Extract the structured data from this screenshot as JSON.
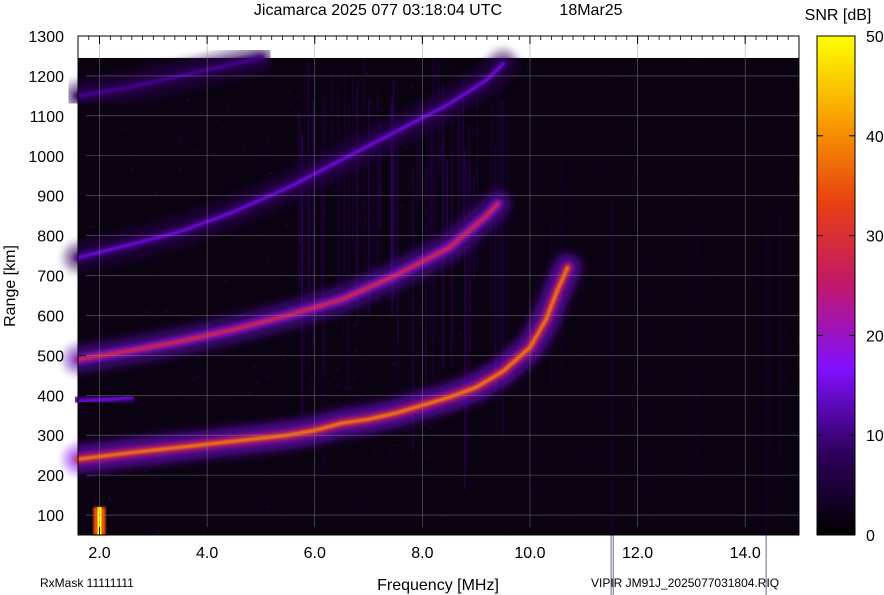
{
  "header": {
    "title": "Jicamarca 2025 077 03:18:04 UTC",
    "date": "18Mar25"
  },
  "footer": {
    "rxmask": "RxMask 11111111",
    "file": "VIPIR  JM91J_2025077031804.RIQ"
  },
  "chart_data": {
    "type": "heatmap",
    "title": "Jicamarca 2025 077 03:18:04 UTC",
    "xlabel": "Frequency [MHz]",
    "ylabel": "Range [km]",
    "xlim": [
      1.6,
      15.0
    ],
    "ylim": [
      50,
      1300
    ],
    "x_ticks": [
      {
        "value": 2,
        "label": "2.0"
      },
      {
        "value": 4,
        "label": "4.0"
      },
      {
        "value": 6,
        "label": "6.0"
      },
      {
        "value": 8,
        "label": "8.0"
      },
      {
        "value": 10,
        "label": "10.0"
      },
      {
        "value": 12,
        "label": "12.0"
      },
      {
        "value": 14,
        "label": "14.0"
      }
    ],
    "y_ticks": [
      {
        "value": 100,
        "label": "100"
      },
      {
        "value": 200,
        "label": "200"
      },
      {
        "value": 300,
        "label": "300"
      },
      {
        "value": 400,
        "label": "400"
      },
      {
        "value": 500,
        "label": "500"
      },
      {
        "value": 600,
        "label": "600"
      },
      {
        "value": 700,
        "label": "700"
      },
      {
        "value": 800,
        "label": "800"
      },
      {
        "value": 900,
        "label": "900"
      },
      {
        "value": 1000,
        "label": "1000"
      },
      {
        "value": 1100,
        "label": "1100"
      },
      {
        "value": 1200,
        "label": "1200"
      },
      {
        "value": 1300,
        "label": "1300"
      }
    ],
    "grid": true,
    "data_range_top_km": 1245,
    "colorbar": {
      "label": "SNR [dB]",
      "range": [
        0,
        50
      ],
      "ticks": [
        {
          "value": 0,
          "label": "0"
        },
        {
          "value": 10,
          "label": "10"
        },
        {
          "value": 20,
          "label": "20"
        },
        {
          "value": 30,
          "label": "30"
        },
        {
          "value": 40,
          "label": "40"
        },
        {
          "value": 50,
          "label": "50"
        }
      ],
      "stops": [
        "#000000",
        "#30005e",
        "#8010ff",
        "#c0186a",
        "#e84010",
        "#f8a000",
        "#ffff00"
      ]
    },
    "traces": [
      {
        "id": "first-hop",
        "points": [
          [
            1.6,
            240
          ],
          [
            2.5,
            255
          ],
          [
            3.5,
            270
          ],
          [
            4.5,
            285
          ],
          [
            5.5,
            300
          ],
          [
            6.0,
            312
          ],
          [
            6.5,
            330
          ],
          [
            7.0,
            340
          ],
          [
            7.5,
            355
          ],
          [
            8.0,
            375
          ],
          [
            8.5,
            395
          ],
          [
            9.0,
            420
          ],
          [
            9.5,
            460
          ],
          [
            10.0,
            520
          ],
          [
            10.3,
            590
          ],
          [
            10.5,
            660
          ],
          [
            10.7,
            720
          ]
        ],
        "snr_db": 38
      },
      {
        "id": "second-hop",
        "points": [
          [
            1.6,
            490
          ],
          [
            2.5,
            510
          ],
          [
            3.5,
            535
          ],
          [
            4.5,
            565
          ],
          [
            5.5,
            600
          ],
          [
            6.5,
            640
          ],
          [
            7.5,
            700
          ],
          [
            8.5,
            770
          ],
          [
            9.2,
            850
          ],
          [
            9.4,
            880
          ]
        ],
        "snr_db": 28
      },
      {
        "id": "third-hop",
        "points": [
          [
            1.6,
            745
          ],
          [
            2.5,
            775
          ],
          [
            3.5,
            810
          ],
          [
            4.5,
            860
          ],
          [
            5.5,
            920
          ],
          [
            6.5,
            990
          ],
          [
            7.5,
            1060
          ],
          [
            8.5,
            1130
          ],
          [
            9.2,
            1190
          ],
          [
            9.5,
            1230
          ]
        ],
        "snr_db": 14
      },
      {
        "id": "upper-echo",
        "points": [
          [
            1.6,
            1150
          ],
          [
            2.5,
            1170
          ],
          [
            3.5,
            1200
          ],
          [
            4.5,
            1230
          ],
          [
            5.0,
            1245
          ]
        ],
        "snr_db": 11
      },
      {
        "id": "es-echo",
        "points": [
          [
            1.6,
            385
          ],
          [
            2.2,
            390
          ],
          [
            2.6,
            395
          ]
        ],
        "snr_db": 14
      }
    ],
    "interference_spike": {
      "frequency_mhz": 2.0,
      "range_km": [
        50,
        120
      ],
      "snr_db": 50
    }
  }
}
